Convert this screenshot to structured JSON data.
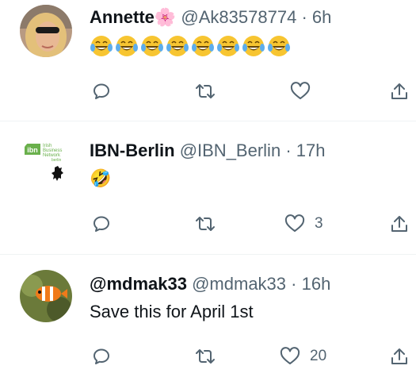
{
  "tweets": [
    {
      "display_name": "Annette",
      "name_emoji": "🌸",
      "handle": "@Ak83578774",
      "separator": "·",
      "time": "6h",
      "text": "",
      "emoji_count": 8,
      "avatar": "woman-sunglasses-avatar",
      "counts": {
        "reply": "",
        "retweet": "",
        "like": ""
      }
    },
    {
      "display_name": "IBN-Berlin",
      "handle": "@IBN_Berlin",
      "separator": "·",
      "time": "17h",
      "text": "🤣",
      "avatar_logo": {
        "badge": "ibn",
        "line1": "Irish",
        "line2": "Business",
        "line3": "Network",
        "line4": "berlin"
      },
      "counts": {
        "reply": "",
        "retweet": "",
        "like": "3"
      }
    },
    {
      "display_name": "@mdmak33",
      "handle": "@mdmak33",
      "separator": "·",
      "time": "16h",
      "text": "Save this for April 1st",
      "avatar": "clownfish-avatar",
      "counts": {
        "reply": "",
        "retweet": "",
        "like": "20"
      }
    }
  ],
  "icons": {
    "reply": "reply-icon",
    "retweet": "retweet-icon",
    "like": "heart-icon",
    "share": "share-icon"
  },
  "colors": {
    "text": "#0f1419",
    "secondary": "#536471",
    "divider": "#eff3f4",
    "ibn_green": "#6ab04c"
  }
}
